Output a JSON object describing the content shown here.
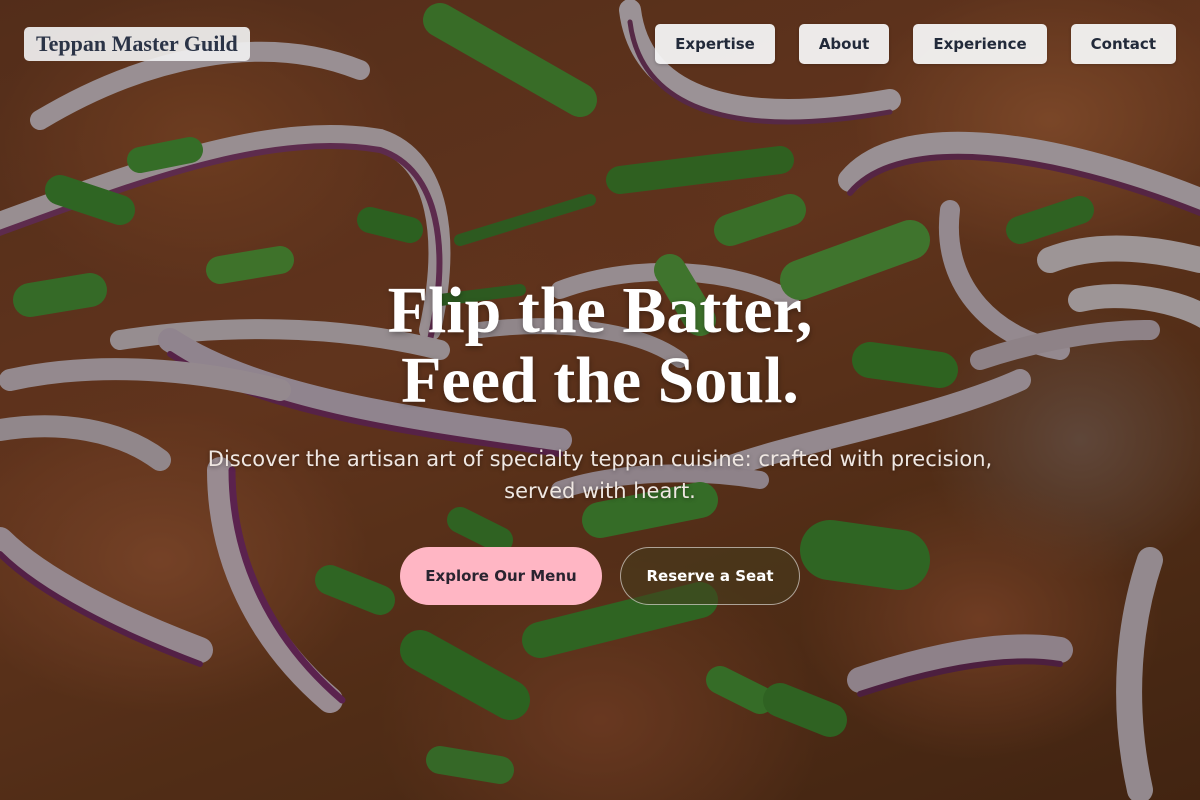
{
  "brand": {
    "name": "Teppan Master Guild"
  },
  "nav": {
    "items": [
      {
        "label": "Expertise"
      },
      {
        "label": "About"
      },
      {
        "label": "Experience"
      },
      {
        "label": "Contact"
      }
    ]
  },
  "hero": {
    "title_line1": "Flip the Batter,",
    "title_line2": "Feed the Soul.",
    "subtitle": "Discover the artisan art of specialty teppan cuisine: crafted with precision, served with heart.",
    "primary_cta": "Explore Our Menu",
    "secondary_cta": "Reserve a Seat",
    "background_image": "food-dish-with-red-onion-and-green-onion"
  },
  "colors": {
    "primary_cta_bg": "#ffb6c4",
    "nav_bg": "#f4f4f4",
    "brand_text": "#2b3447"
  }
}
